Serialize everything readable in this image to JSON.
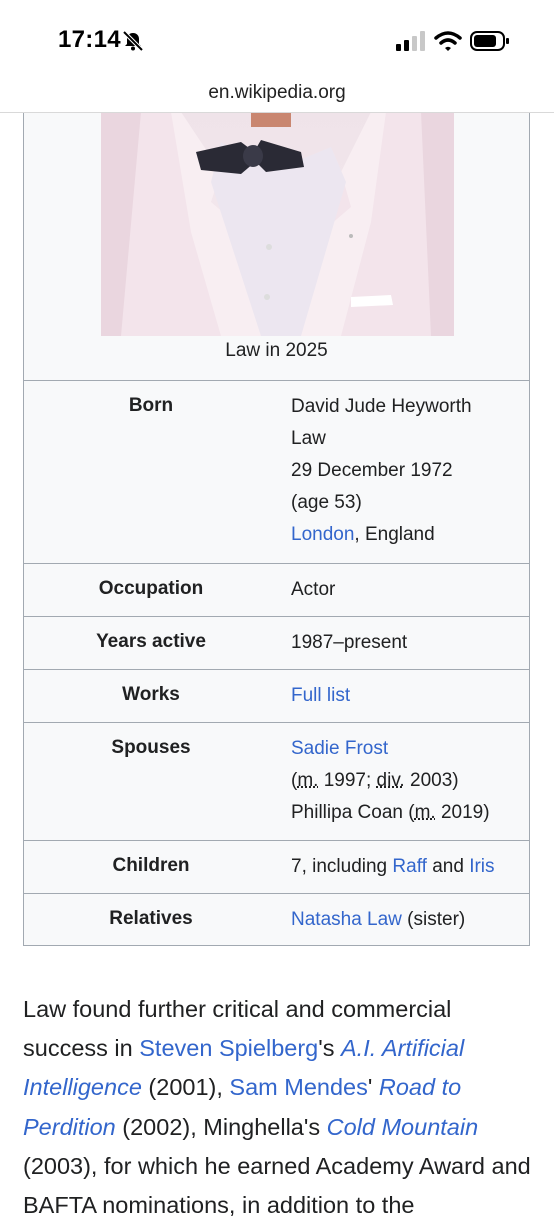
{
  "status_bar": {
    "time": "17:14"
  },
  "browser": {
    "url": "en.wikipedia.org"
  },
  "infobox": {
    "caption": "Law in 2025",
    "born": {
      "label": "Born",
      "name_line1": "David Jude Heyworth",
      "name_line2": "Law",
      "date": "29 December 1972",
      "age": "(age 53)",
      "place_link": "London",
      "place_rest": ", England"
    },
    "occupation": {
      "label": "Occupation",
      "value": "Actor"
    },
    "years_active": {
      "label": "Years active",
      "value": "1987–present"
    },
    "works": {
      "label": "Works",
      "link": "Full list"
    },
    "spouses": {
      "label": "Spouses",
      "spouse1": "Sadie Frost",
      "m_abbr": "m.",
      "div_abbr": "div.",
      "spouse1_open": "(",
      "spouse1_m_year": " 1997; ",
      "spouse1_div_year": " 2003)",
      "spouse2": "Phillipa Coan (",
      "spouse2_year": " 2019)"
    },
    "children": {
      "label": "Children",
      "prefix": "7, including ",
      "child1": "Raff",
      "and": " and ",
      "child2": "Iris"
    },
    "relatives": {
      "label": "Relatives",
      "link": "Natasha Law",
      "rest": " (sister)"
    }
  },
  "paragraph": {
    "t1": "Law found further critical and commercial success in ",
    "l1": "Steven Spielberg",
    "t2": "'s ",
    "l2": "A.I. Artificial Intelligence",
    "t3": " (2001), ",
    "l3": "Sam Mendes",
    "t4": "' ",
    "l4": "Road to Perdition",
    "t5": " (2002), Minghella's ",
    "l5": "Cold Mountain",
    "t6": " (2003), for which he earned Academy Award and BAFTA nominations, in addition to the"
  }
}
